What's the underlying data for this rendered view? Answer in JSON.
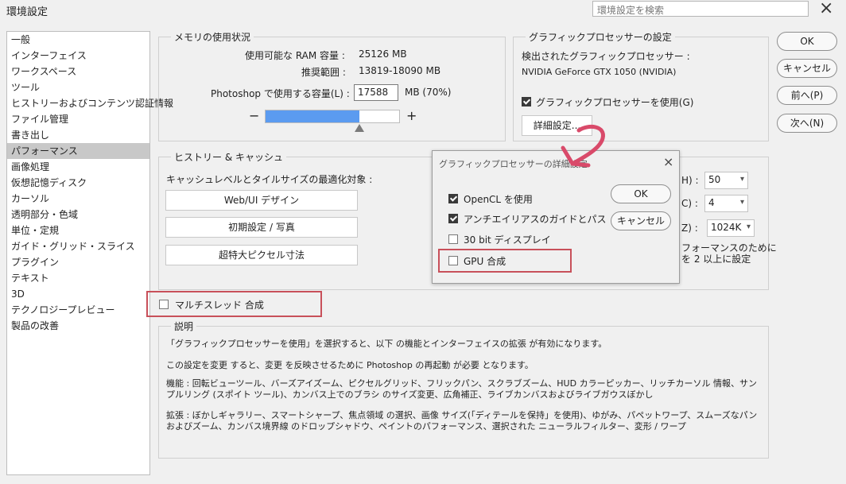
{
  "window": {
    "title": "環境設定",
    "search_placeholder": "環境設定を検索",
    "close_glyph": "×"
  },
  "sidebar": {
    "items": [
      {
        "label": "一般"
      },
      {
        "label": "インターフェイス"
      },
      {
        "label": "ワークスペース"
      },
      {
        "label": "ツール"
      },
      {
        "label": "ヒストリーおよびコンテンツ認証情報"
      },
      {
        "label": "ファイル管理"
      },
      {
        "label": "書き出し"
      },
      {
        "label": "パフォーマンス",
        "active": true
      },
      {
        "label": "画像処理"
      },
      {
        "label": "仮想記憶ディスク"
      },
      {
        "label": "カーソル"
      },
      {
        "label": "透明部分・色域"
      },
      {
        "label": "単位・定規"
      },
      {
        "label": "ガイド・グリッド・スライス"
      },
      {
        "label": "プラグイン"
      },
      {
        "label": "テキスト"
      },
      {
        "label": "3D"
      },
      {
        "label": "テクノロジープレビュー"
      },
      {
        "label": "製品の改善"
      }
    ]
  },
  "memory": {
    "legend": "メモリの使用状況",
    "available_label": "使用可能な RAM 容量 :",
    "available_value": "25126 MB",
    "recommended_label": "推奨範囲 :",
    "recommended_value": "13819-18090 MB",
    "use_label": "Photoshop で使用する容量(L) :",
    "use_value": "17588",
    "use_unit": "MB (70%)",
    "minus": "−",
    "plus": "+",
    "slider_fraction": 0.7
  },
  "gpu": {
    "legend": "グラフィックプロセッサーの設定",
    "detected_label": "検出されたグラフィックプロセッサー :",
    "gpu_name": "NVIDIA GeForce GTX 1050 (NVIDIA)",
    "use_gpu_label": "グラフィックプロセッサーを使用(G)",
    "use_gpu_checked": true,
    "advanced_button": "詳細設定..."
  },
  "history": {
    "legend": "ヒストリー & キャッシュ",
    "optimize_label": "キャッシュレベルとタイルサイズの最適化対象 :",
    "buttons": [
      "Web/UI デザイン",
      "初期設定 / 写真",
      "超特大ピクセル寸法"
    ],
    "fields": [
      {
        "suffix": "H) :",
        "value": "50"
      },
      {
        "suffix": "C) :",
        "value": "4"
      },
      {
        "suffix": "Z) :",
        "value": "1024K"
      }
    ],
    "note_line1": "フォーマンスのために",
    "note_line2": "を 2 以上に設定"
  },
  "multithread": {
    "label": "マルチスレッド 合成",
    "checked": false
  },
  "description": {
    "legend": "説明",
    "p1": "「グラフィックプロセッサーを使用」を選択すると、以下 の機能とインターフェイスの拡張 が有効になります。",
    "p2": "この設定を変更 すると、変更 を反映させるために Photoshop の再起動 が必要 となります。",
    "p3": "機能 : 回転ビューツール、バーズアイズーム、ピクセルグリッド、フリックパン、スクラブズーム、HUD カラーピッカー、リッチカーソル 情報、サンプルリング (スポイト ツール)、カンバス上でのブラシ のサイズ変更、広角補正、ライブカンバスおよびライブガウスぼかし",
    "p4": "拡張 : ぼかしギャラリー、スマートシャープ、焦点領域 の選択、画像 サイズ(「ディテールを保持」を使用)、ゆがみ、パペットワープ、スムーズなパンおよびズーム、カンバス境界線 のドロップシャドウ、ペイントのパフォーマンス、選択された ニューラルフィルター、変形 / ワープ"
  },
  "right_buttons": {
    "ok": "OK",
    "cancel": "キャンセル",
    "prev": "前へ(P)",
    "next": "次へ(N)"
  },
  "advanced_dialog": {
    "title": "グラフィックプロセッサーの詳細設定",
    "close_glyph": "×",
    "options": [
      {
        "label": "OpenCL を使用",
        "checked": true
      },
      {
        "label": "アンチエイリアスのガイドとパス",
        "checked": true
      },
      {
        "label": "30 bit ディスプレイ",
        "checked": false
      },
      {
        "label": "GPU 合成",
        "checked": false
      }
    ],
    "ok": "OK",
    "cancel": "キャンセル"
  },
  "colors": {
    "accent": "#5b9bf0",
    "highlight": "#c8505a",
    "annotation": "#d94a6a"
  }
}
